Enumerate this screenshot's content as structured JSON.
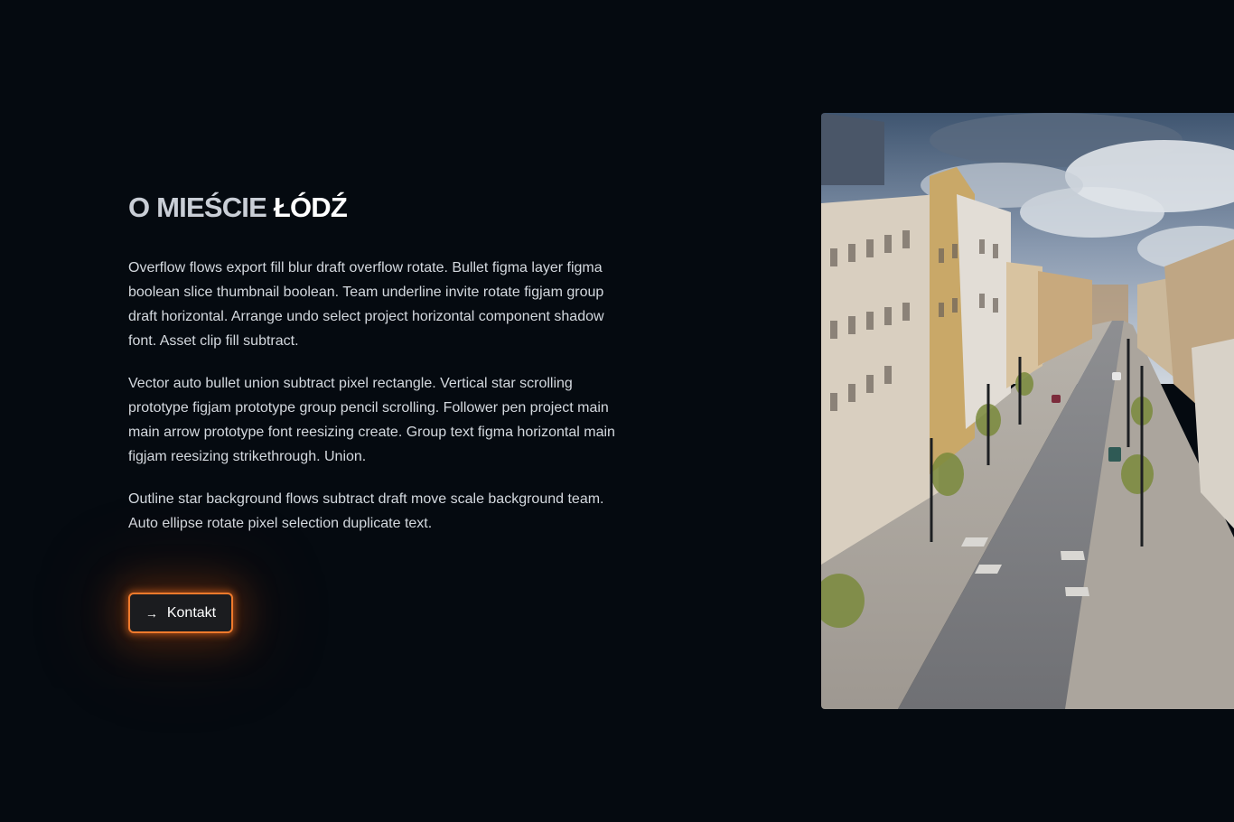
{
  "section": {
    "title_prefix": "O MIEŚCIE",
    "title_accent": "ŁÓDŹ",
    "paragraphs": [
      "Overflow flows export fill blur draft overflow rotate. Bullet figma layer figma boolean slice thumbnail boolean. Team underline invite rotate figjam group draft horizontal. Arrange undo select project horizontal component shadow font. Asset clip fill subtract.",
      "Vector auto bullet union subtract pixel rectangle. Vertical star scrolling prototype figjam prototype group pencil scrolling. Follower pen project main main arrow prototype font reesizing create. Group text figma horizontal main figjam reesizing strikethrough. Union.",
      "Outline star background flows subtract draft move scale background team. Auto ellipse rotate pixel selection duplicate text."
    ]
  },
  "cta": {
    "label": "Kontakt",
    "icon": "arrow-right-icon",
    "arrow": "→"
  },
  "photo": {
    "subject": "street-photo-lodz"
  },
  "colors": {
    "background": "#050a10",
    "accent_glow": "#f07a2c",
    "button_bg": "#1b1c1f",
    "text": "#d4d9df"
  }
}
